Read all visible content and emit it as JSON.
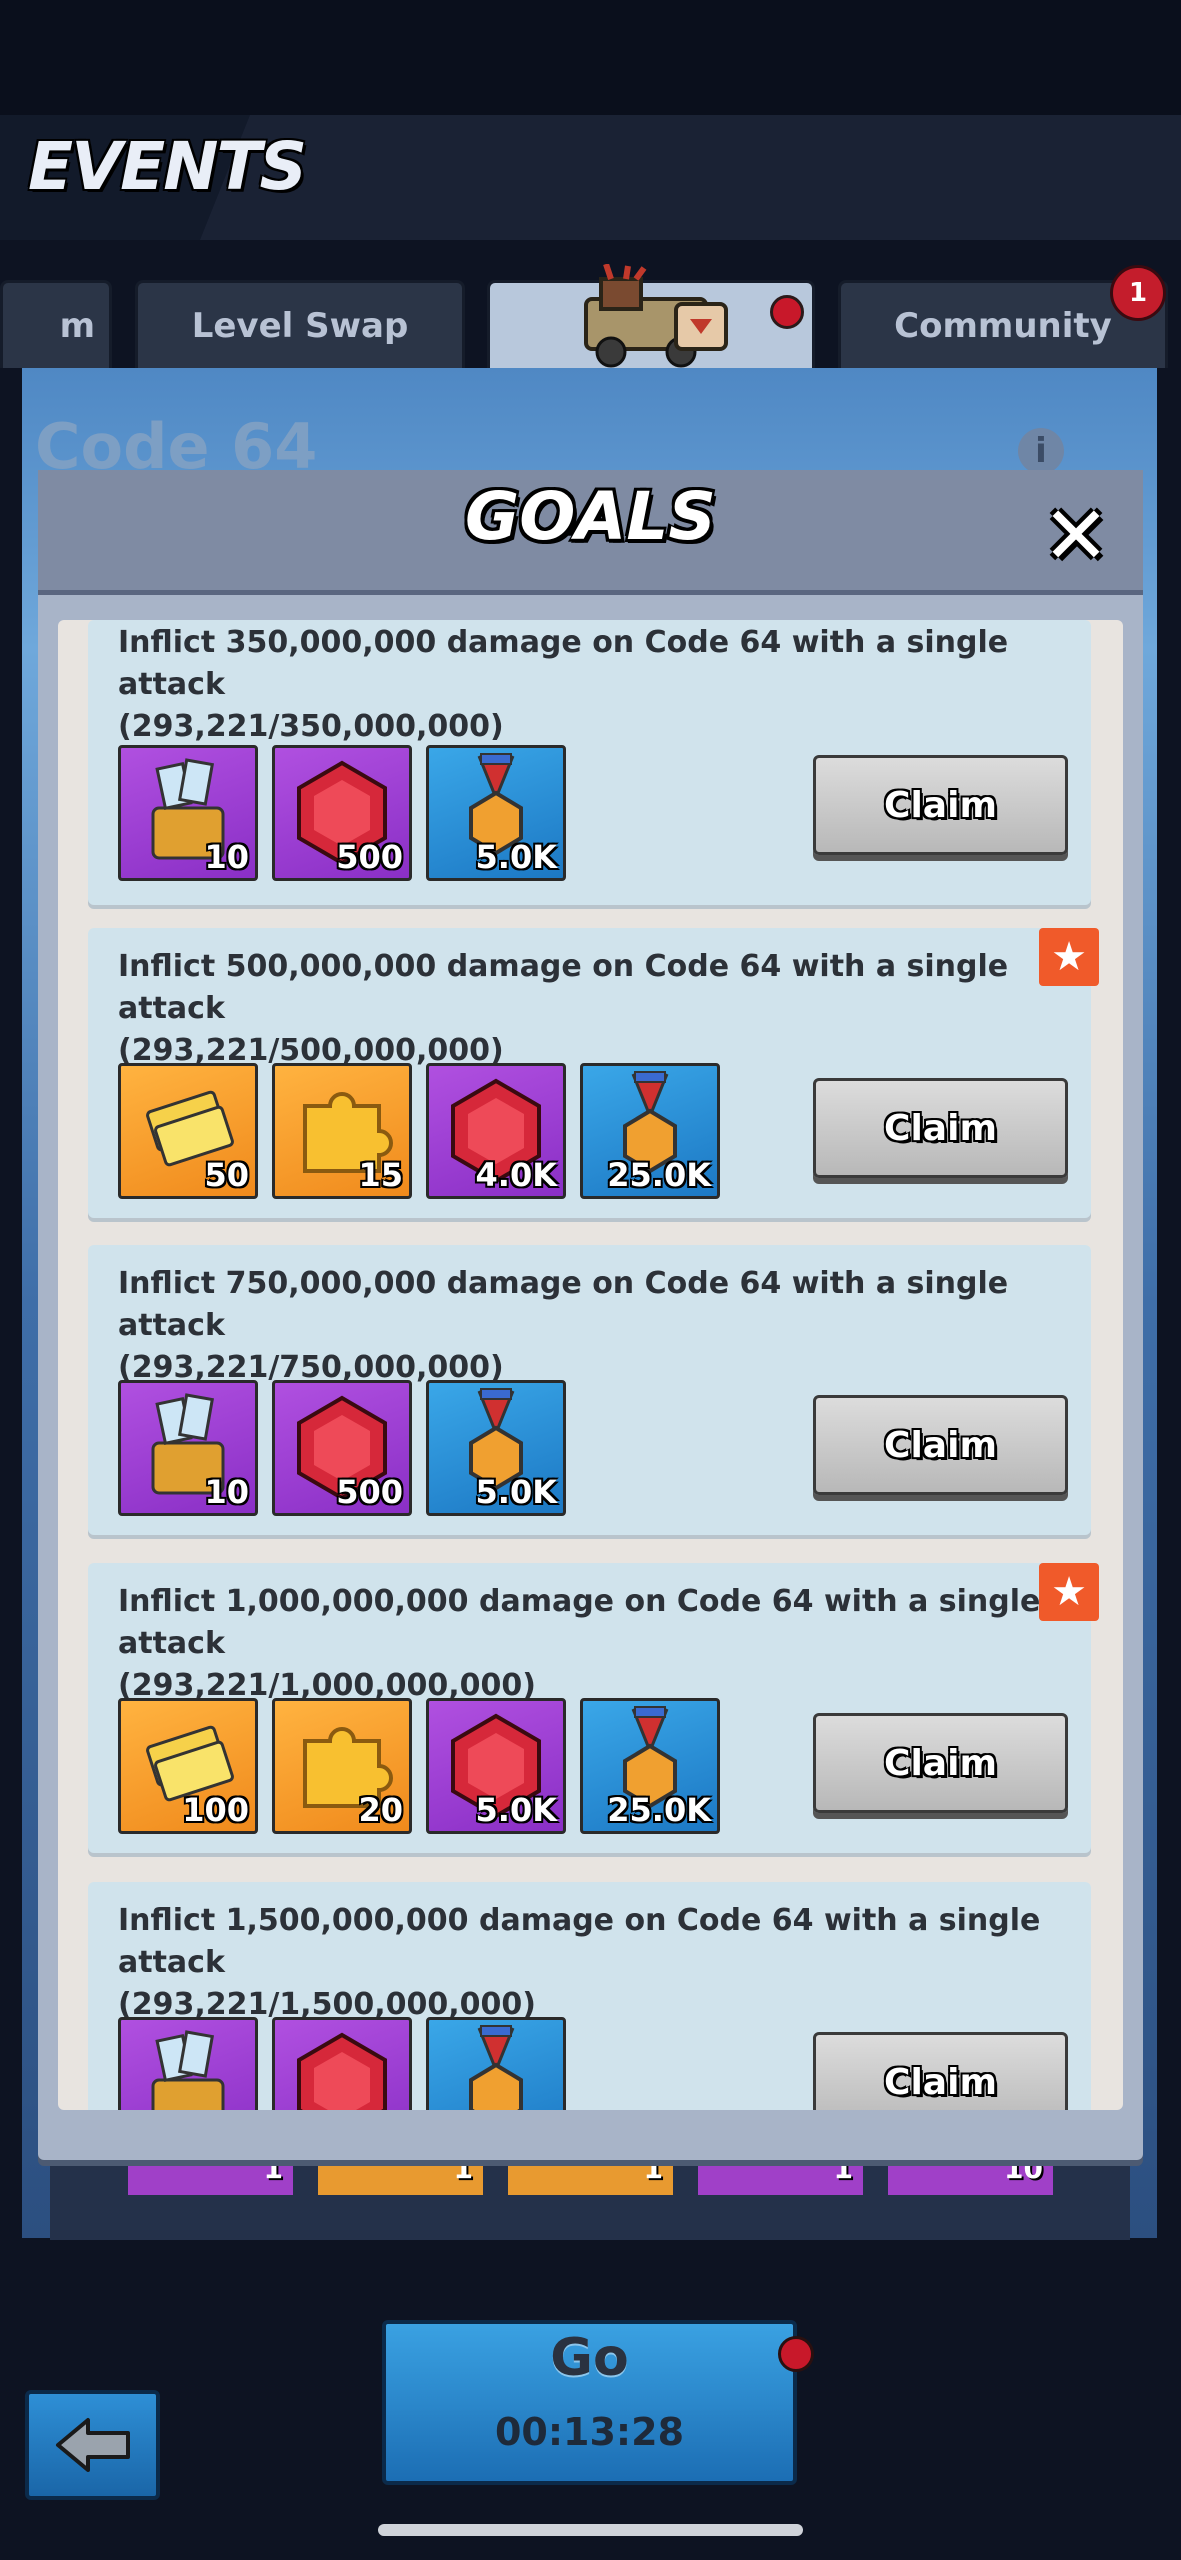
{
  "header": {
    "title": "EVENTS"
  },
  "tabs": [
    {
      "label": "m",
      "active": false
    },
    {
      "label": "Level Swap",
      "active": false
    },
    {
      "label": "",
      "active": true,
      "has_dot": true
    },
    {
      "label": "Community",
      "active": false,
      "badge": "1"
    }
  ],
  "event": {
    "title": "Code 64",
    "info_icon": "info-icon"
  },
  "background_rewards": [
    "1",
    "1",
    "1",
    "1",
    "10"
  ],
  "modal": {
    "title": "GOALS",
    "close_icon": "close-icon",
    "goals": [
      {
        "text": "Inflict 350,000,000 damage on Code 64 with a single attack",
        "progress": "(293,221/350,000,000)",
        "featured": false,
        "rewards": [
          {
            "icon": "ticket-chest-icon",
            "color": "purple",
            "qty": "10"
          },
          {
            "icon": "gem-icon",
            "color": "purple",
            "qty": "500"
          },
          {
            "icon": "medal-icon",
            "color": "blue",
            "qty": "5.0K"
          }
        ],
        "claim_label": "Claim"
      },
      {
        "text": "Inflict 500,000,000 damage on Code 64 with a single attack",
        "progress": "(293,221/500,000,000)",
        "featured": true,
        "rewards": [
          {
            "icon": "gold-ticket-icon",
            "color": "orange",
            "qty": "50"
          },
          {
            "icon": "puzzle-piece-icon",
            "color": "orange",
            "qty": "15"
          },
          {
            "icon": "gem-icon",
            "color": "purple",
            "qty": "4.0K"
          },
          {
            "icon": "medal-icon",
            "color": "blue",
            "qty": "25.0K"
          }
        ],
        "claim_label": "Claim"
      },
      {
        "text": "Inflict 750,000,000 damage on Code 64 with a single attack",
        "progress": "(293,221/750,000,000)",
        "featured": false,
        "rewards": [
          {
            "icon": "ticket-chest-icon",
            "color": "purple",
            "qty": "10"
          },
          {
            "icon": "gem-icon",
            "color": "purple",
            "qty": "500"
          },
          {
            "icon": "medal-icon",
            "color": "blue",
            "qty": "5.0K"
          }
        ],
        "claim_label": "Claim"
      },
      {
        "text": "Inflict 1,000,000,000 damage on Code 64 with a single attack",
        "progress": "(293,221/1,000,000,000)",
        "featured": true,
        "rewards": [
          {
            "icon": "gold-ticket-icon",
            "color": "orange",
            "qty": "100"
          },
          {
            "icon": "puzzle-piece-icon",
            "color": "orange",
            "qty": "20"
          },
          {
            "icon": "gem-icon",
            "color": "purple",
            "qty": "5.0K"
          },
          {
            "icon": "medal-icon",
            "color": "blue",
            "qty": "25.0K"
          }
        ],
        "claim_label": "Claim"
      },
      {
        "text": "Inflict 1,500,000,000 damage on Code 64 with a single attack",
        "progress": "(293,221/1,500,000,000)",
        "featured": false,
        "rewards": [
          {
            "icon": "ticket-chest-icon",
            "color": "purple",
            "qty": ""
          },
          {
            "icon": "gem-icon",
            "color": "purple",
            "qty": ""
          },
          {
            "icon": "medal-icon",
            "color": "blue",
            "qty": ""
          }
        ],
        "claim_label": "Claim"
      }
    ]
  },
  "footer": {
    "back_icon": "back-arrow-icon",
    "go_label": "Go",
    "timer": "00:13:28"
  },
  "colors": {
    "claim_button": "#c8c8c8",
    "star_badge": "#f05a2a",
    "notification_dot": "#c8182a",
    "card_bg": "#d0e3ec"
  }
}
